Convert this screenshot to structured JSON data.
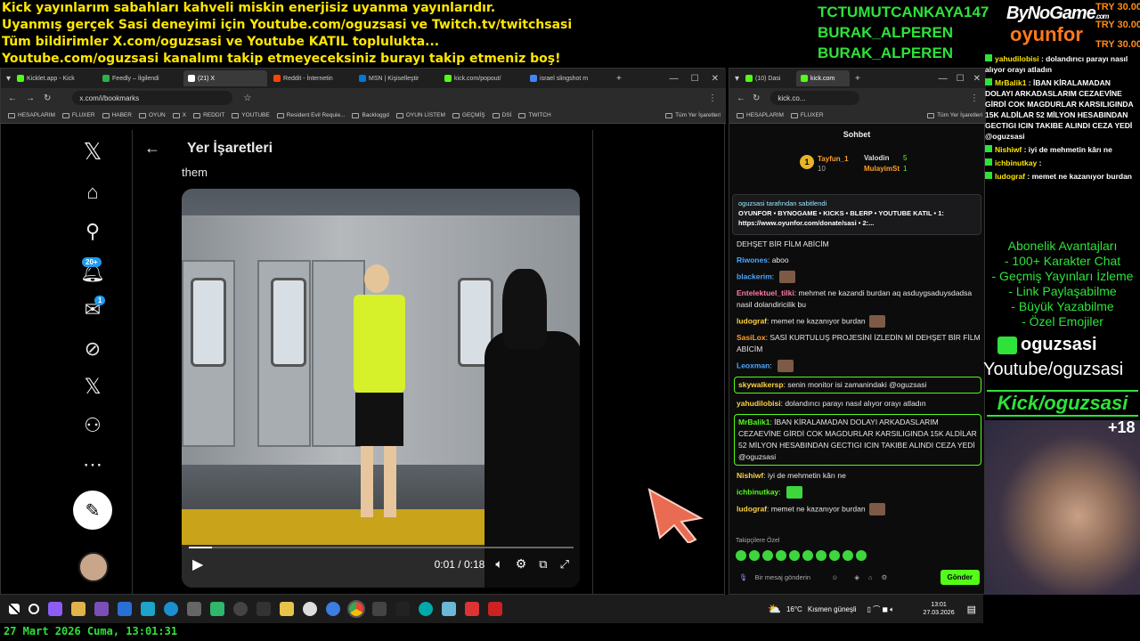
{
  "banner": {
    "line1": "Kick yayınlarım sabahları kahveli miskin enerjisiz uyanma yayınlarıdır.",
    "line2": "Uyanmış gerçek Sasi deneyimi için Youtube.com/oguzsasi ve Twitch.tv/twitchsasi",
    "line3": "Tüm bildirimler X.com/oguzsasi ve Youtube KATIL topluluktа...",
    "line4": "Youtube.com/oguzsasi kanalımı takip etmeyeceksiniz burayı takip etmeniz boş!"
  },
  "donors": [
    "TCTUMUTCANKAYA147",
    "BURAK_ALPEREN",
    "BURAK_ALPEREN"
  ],
  "brand": {
    "top": "ByNoGame",
    "top_suffix": ".com",
    "bottom": "oyunfor"
  },
  "try_amounts": [
    "TRY 30.00",
    "TRY 30.00",
    "TRY 30.00"
  ],
  "left_browser": {
    "tabs": [
      "Kicklet.app - Kick",
      "Feedly – İlgilendi",
      "(21) X",
      "Reddit - İnternetin",
      "MSN | Kişiselleştir",
      "kick.com/popout/",
      "israel slingshot m"
    ],
    "url": "x.com/i/bookmarks",
    "bookmarks": [
      "HESAPLARIM",
      "FLUXER",
      "HABER",
      "OYUN",
      "X",
      "REDDIT",
      "YOUTUBE",
      "Resident Evil Requie...",
      "Backloggd",
      "OYUN LİSTEM",
      "GEÇMİŞ",
      "DSİ",
      "TWITCH",
      "Tüm Yer İşaretleri"
    ],
    "page_title": "Yer İşaretleri",
    "post_text": "them",
    "video_time": "0:01 / 0:18",
    "video_progress": 0.06,
    "notif_badge": "20+",
    "msg_badge": "1"
  },
  "right_browser": {
    "tabs": [
      "(10) Dasi",
      "kick.com"
    ],
    "url": "kick.co...",
    "bookmarks": [
      "HESAPLARIM",
      "FLUXER",
      "Tüm Yer İşaretleri"
    ],
    "chat_title": "Sohbet",
    "leader": {
      "first": "Tayfun_1",
      "first_count": "10",
      "second": "Valodin",
      "second_count": "5",
      "third": "MulayimSt",
      "third_count": "1"
    },
    "pinned_by": "oguzsasi tarafından sabitlendi",
    "pinned_text": "OYUNFOR • BYNOGAME • KICKS • BLERP • YOUTUBE KATIL • 1: https://www.oyunfor.com/donate/sasi • 2:...",
    "messages": [
      {
        "user": "",
        "text": "DEHŞET BİR FİLM ABİCİM",
        "color": "plain"
      },
      {
        "user": "Riwones",
        "text": "aboo",
        "color": "blue"
      },
      {
        "user": "blackerim",
        "text": "",
        "color": "blue",
        "emote": true
      },
      {
        "user": "Entelektuel_tilki",
        "text": "mehmet ne kazandi burdan aq asduygsaduysdadsa nasil dolandiricilik bu",
        "color": "pink"
      },
      {
        "user": "ludograf",
        "text": "memet ne kazanıyor burdan",
        "color": "yellow",
        "emote": true
      },
      {
        "user": "SasiLox",
        "text": "SASİ KURTULUŞ PROJESİNİ İZLEDİN Mİ DEHŞET BİR FİLM ABİCİM",
        "color": "orange"
      },
      {
        "user": "Leoxman",
        "text": "",
        "color": "blue",
        "emote": true
      },
      {
        "user": "skywalkersp",
        "text": "senin monitor isi zamanindaki @oguzsasi",
        "color": "yellow",
        "hl": true
      },
      {
        "user": "yahudilobisi",
        "text": "dolandırıcı parayı nasıl alıyor orayı atladın",
        "color": "yellow"
      },
      {
        "user": "MrBalik1",
        "text": "İBAN KİRALAMADAN DOLAYI ARKADASLARIM CEZAEVİNE GİRDİ COK MAGDURLAR KARSILIGINDA 15K ALDİLAR 52 MİLYON HESABINDAN GECTIGI ICIN TAKIBE ALINDI CEZA YEDİ @oguzsasi",
        "color": "green",
        "hl": true
      },
      {
        "user": "Nishiwf",
        "text": "iyi de mehmetin kârı ne",
        "color": "yellow"
      },
      {
        "user": "ichbinutkay",
        "text": "",
        "color": "green",
        "emote_g": true
      },
      {
        "user": "ludograf",
        "text": "memet ne kazanıyor burdan",
        "color": "yellow",
        "emote": true
      }
    ],
    "follower_only": "Takipçilere Özel",
    "input_placeholder": "Bir mesaj gönderin",
    "send": "Gönder"
  },
  "overlay_chat": [
    {
      "user": "yahudilobisi",
      "text": "dolandırıcı parayı nasıl alıyor orayı atladın"
    },
    {
      "user": "MrBalik1",
      "text": "İBAN KİRALAMADAN DOLAYI ARKADASLARIM CEZAEVİNE GİRDİ COK MAGDURLAR KARSILIGINDA 15K ALDİLAR 52 MİLYON HESABINDAN GECTIGI ICIN TAKIBE ALINDI CEZA YEDİ @oguzsasi"
    },
    {
      "user": "Nishiwf",
      "text": "iyi de mehmetin kârı ne"
    },
    {
      "user": "ichbinutkay",
      "text": ""
    },
    {
      "user": "ludograf",
      "text": "memet ne kazanıyor burdan"
    }
  ],
  "perks": {
    "title": "Abonelik Avantajları",
    "items": [
      "- 100+ Karakter Chat",
      "- Geçmiş Yayınları İzleme",
      "- Link Paylaşabilme",
      "- Büyük Yazabilme",
      "- Özel Emojiler"
    ]
  },
  "kick_name": "oguzsasi",
  "youtube_line": "Youtube/oguzsasi",
  "kick_line": "Kick/oguzsasi",
  "cam_plus": "+18",
  "taskbar": {
    "weather": "16°C",
    "weather_text": "Kısmen güneşli",
    "time": "13:01",
    "date": "27.03.2026"
  },
  "footer_date": "27 Mart 2026 Cuma, 13:01:31"
}
